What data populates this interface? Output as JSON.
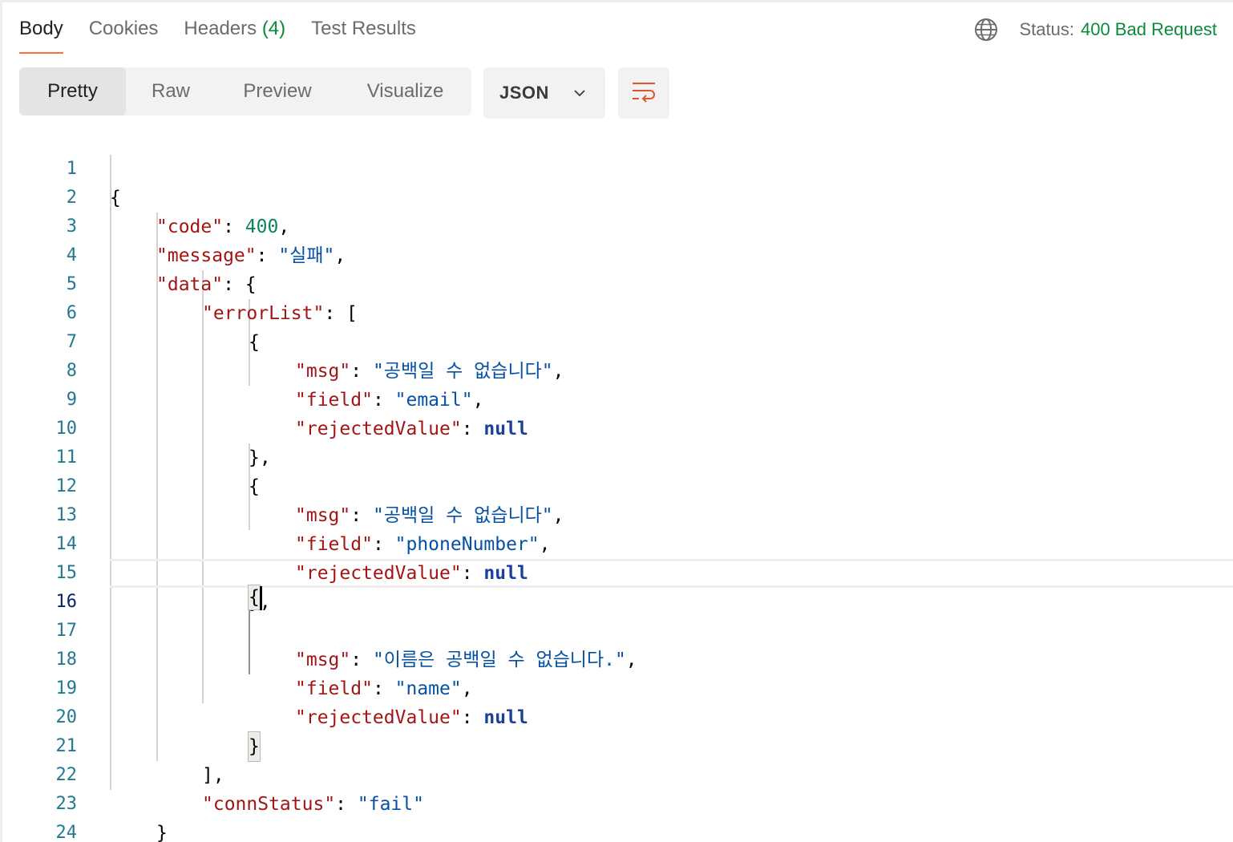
{
  "tabs": {
    "body": "Body",
    "cookies": "Cookies",
    "headers": "Headers",
    "headers_count": "(4)",
    "test_results": "Test Results"
  },
  "status": {
    "label": "Status:",
    "value": "400 Bad Request",
    "icon": "globe-icon"
  },
  "view_modes": {
    "pretty": "Pretty",
    "raw": "Raw",
    "preview": "Preview",
    "visualize": "Visualize",
    "active": "Pretty"
  },
  "format": {
    "selected": "JSON",
    "icon": "chevron-down-icon"
  },
  "wrap_button": {
    "icon": "wrap-lines-icon"
  },
  "colors": {
    "accent": "#ff6c37",
    "status_ok": "#0c8a3c",
    "line_number": "#237893",
    "json_key": "#a31515",
    "json_string": "#0451a5",
    "json_number": "#098658",
    "json_null": "#1a3f9c"
  },
  "editor": {
    "current_line": 16,
    "line_numbers": [
      "1",
      "2",
      "3",
      "4",
      "5",
      "6",
      "7",
      "8",
      "9",
      "10",
      "11",
      "12",
      "13",
      "14",
      "15",
      "16",
      "17",
      "18",
      "19",
      "20",
      "21",
      "22",
      "23",
      "24"
    ],
    "lines": {
      "l1": {
        "a": "{"
      },
      "l2": {
        "k": "\"code\"",
        "p1": ": ",
        "v": "400",
        "p2": ","
      },
      "l3": {
        "k": "\"message\"",
        "p1": ": ",
        "v": "\"실패\"",
        "p2": ","
      },
      "l4": {
        "k": "\"data\"",
        "p1": ": ",
        "v": "{"
      },
      "l5": {
        "k": "\"errorList\"",
        "p1": ": ",
        "v": "["
      },
      "l6": {
        "a": "{"
      },
      "l7": {
        "k": "\"msg\"",
        "p1": ": ",
        "v": "\"공백일 수 없습니다\"",
        "p2": ","
      },
      "l8": {
        "k": "\"field\"",
        "p1": ": ",
        "v": "\"email\"",
        "p2": ","
      },
      "l9": {
        "k": "\"rejectedValue\"",
        "p1": ": ",
        "v": "null"
      },
      "l10": {
        "a": "},"
      },
      "l11": {
        "a": "{"
      },
      "l12": {
        "k": "\"msg\"",
        "p1": ": ",
        "v": "\"공백일 수 없습니다\"",
        "p2": ","
      },
      "l13": {
        "k": "\"field\"",
        "p1": ": ",
        "v": "\"phoneNumber\"",
        "p2": ","
      },
      "l14": {
        "k": "\"rejectedValue\"",
        "p1": ": ",
        "v": "null"
      },
      "l15": {
        "a": "},"
      },
      "l16": {
        "a": "{"
      },
      "l17": {
        "k": "\"msg\"",
        "p1": ": ",
        "v": "\"이름은 공백일 수 없습니다.\"",
        "p2": ","
      },
      "l18": {
        "k": "\"field\"",
        "p1": ": ",
        "v": "\"name\"",
        "p2": ","
      },
      "l19": {
        "k": "\"rejectedValue\"",
        "p1": ": ",
        "v": "null"
      },
      "l20": {
        "a": "}"
      },
      "l21": {
        "a": "],"
      },
      "l22": {
        "k": "\"connStatus\"",
        "p1": ": ",
        "v": "\"fail\""
      },
      "l23": {
        "a": "}"
      },
      "l24": {
        "a": "}"
      }
    }
  }
}
